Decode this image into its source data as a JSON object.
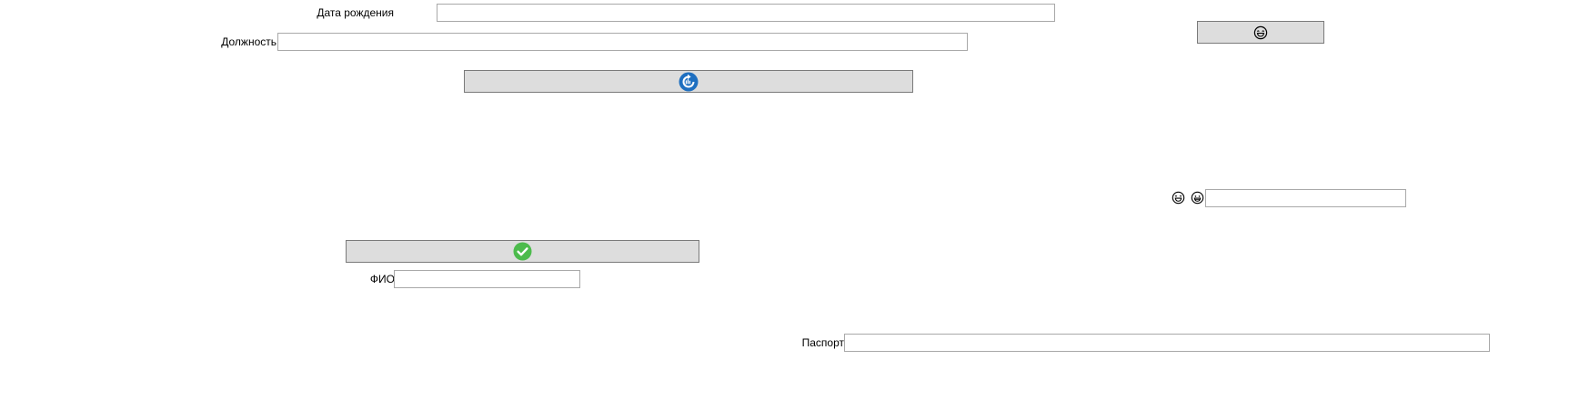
{
  "form": {
    "birth_date": {
      "label": "Дата рождения",
      "value": ""
    },
    "position": {
      "label": "Должность",
      "value": ""
    },
    "full_name": {
      "label": "ФИО",
      "value": ""
    },
    "passport": {
      "label": "Паспорт",
      "value": ""
    },
    "emoji_field": {
      "value": ""
    }
  },
  "buttons": {
    "top_right": {
      "icon": "laughing-face-icon"
    },
    "refresh": {
      "icon": "refresh-icon",
      "color": "#1e6fc0"
    },
    "confirm": {
      "icon": "checkmark-icon",
      "color": "#4cbb4c"
    }
  },
  "emoji_icons": [
    "laughing-face-icon",
    "grinning-face-icon"
  ]
}
